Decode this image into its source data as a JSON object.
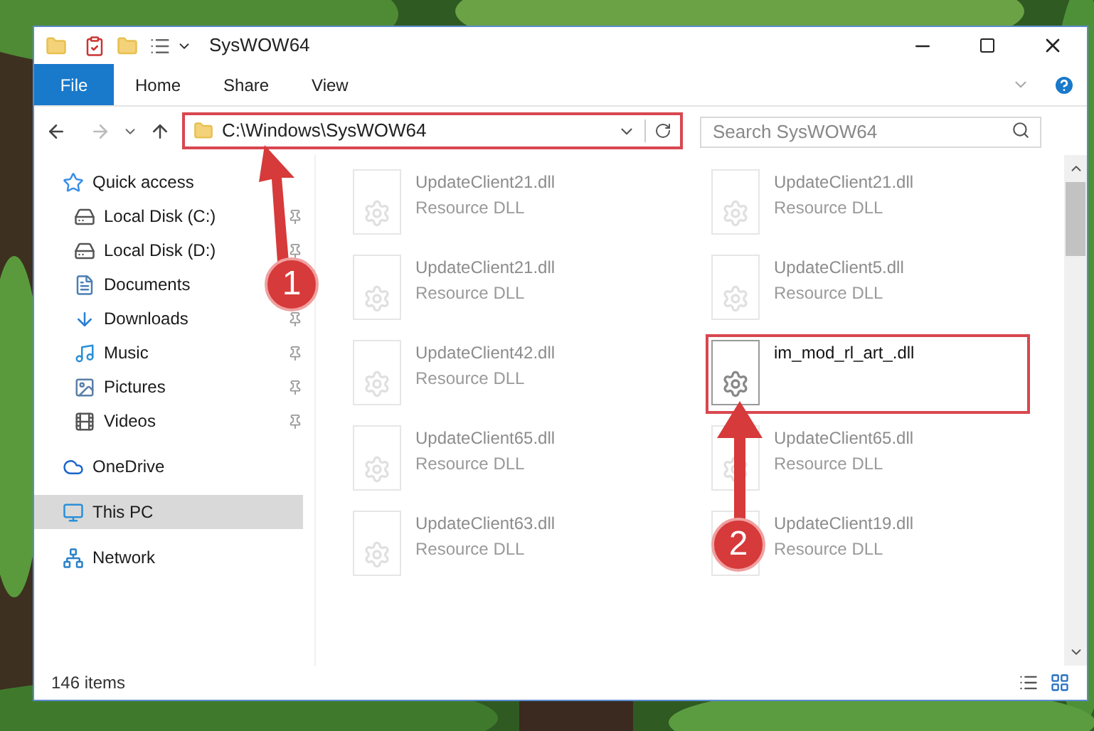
{
  "window": {
    "title": "SysWOW64"
  },
  "ribbon_tabs": [
    {
      "label": "File",
      "kind": "file"
    },
    {
      "label": "Home",
      "kind": "tab"
    },
    {
      "label": "Share",
      "kind": "tab"
    },
    {
      "label": "View",
      "kind": "tab"
    }
  ],
  "address": {
    "path": "C:\\Windows\\SysWOW64",
    "highlighted": true
  },
  "search": {
    "placeholder": "Search SysWOW64"
  },
  "nav": [
    {
      "label": "Quick access",
      "kind": "star",
      "selected": false,
      "children": [
        {
          "label": "Local Disk (C:)",
          "kind": "disk",
          "pinned": true,
          "selected": false
        },
        {
          "label": "Local Disk (D:)",
          "kind": "disk",
          "pinned": true,
          "selected": false
        },
        {
          "label": "Documents",
          "kind": "document",
          "selected": false
        },
        {
          "label": "Downloads",
          "kind": "download",
          "pinned": true,
          "selected": false
        },
        {
          "label": "Music",
          "kind": "music",
          "pinned": true,
          "selected": false
        },
        {
          "label": "Pictures",
          "kind": "pictures",
          "pinned": true,
          "selected": false
        },
        {
          "label": "Videos",
          "kind": "videos",
          "pinned": true,
          "selected": false
        }
      ]
    },
    {
      "label": "OneDrive",
      "kind": "cloud",
      "selected": false
    },
    {
      "label": "This PC",
      "kind": "pc",
      "selected": true
    },
    {
      "label": "Network",
      "kind": "network",
      "selected": false
    }
  ],
  "files": [
    {
      "name": "UpdateClient21.dll",
      "type": "Resource DLL",
      "faded": true,
      "highlighted": false
    },
    {
      "name": "UpdateClient21.dll",
      "type": "Resource DLL",
      "faded": true,
      "highlighted": false
    },
    {
      "name": "UpdateClient21.dll",
      "type": "Resource DLL",
      "faded": true,
      "highlighted": false
    },
    {
      "name": "UpdateClient5.dll",
      "type": "Resource DLL",
      "faded": true,
      "highlighted": false
    },
    {
      "name": "UpdateClient42.dll",
      "type": "Resource DLL",
      "faded": true,
      "highlighted": false
    },
    {
      "name": "im_mod_rl_art_.dll",
      "faded": false,
      "highlighted": true
    },
    {
      "name": "UpdateClient65.dll",
      "type": "Resource DLL",
      "faded": true,
      "highlighted": false
    },
    {
      "name": "UpdateClient65.dll",
      "type": "Resource DLL",
      "faded": true,
      "highlighted": false
    },
    {
      "name": "UpdateClient63.dll",
      "type": "Resource DLL",
      "faded": true,
      "highlighted": false
    },
    {
      "name": "UpdateClient19.dll",
      "type": "Resource DLL",
      "faded": true,
      "highlighted": false
    }
  ],
  "status_bar": {
    "count": "146 items"
  },
  "annotations": [
    {
      "number": "1"
    },
    {
      "number": "2"
    }
  ]
}
